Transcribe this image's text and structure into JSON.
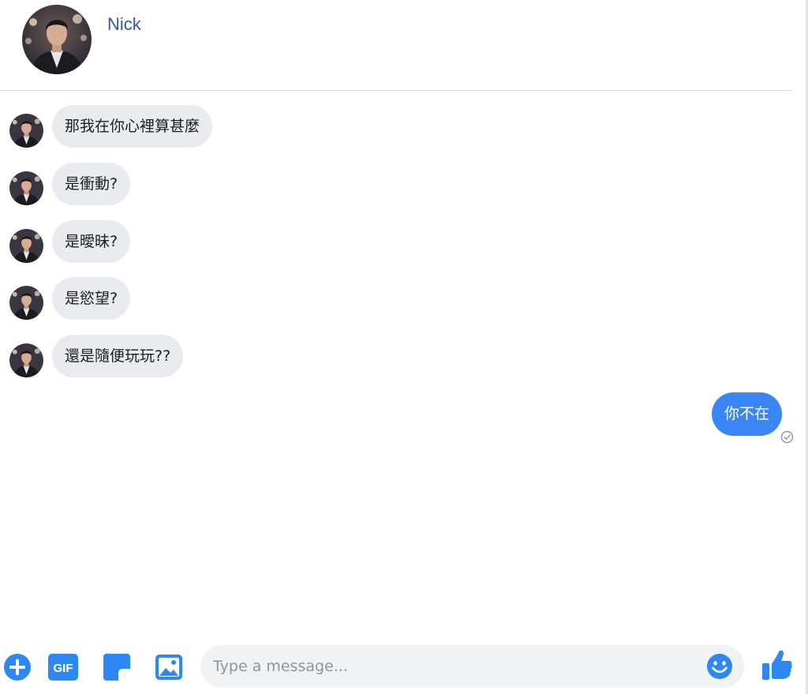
{
  "contact": {
    "name": "Nick",
    "avatar_icon": "profile-photo"
  },
  "messages": [
    {
      "direction": "incoming",
      "text": "那我在你心裡算甚麼"
    },
    {
      "direction": "incoming",
      "text": "是衝動?"
    },
    {
      "direction": "incoming",
      "text": "是曖昧?"
    },
    {
      "direction": "incoming",
      "text": "是慾望?"
    },
    {
      "direction": "incoming",
      "text": "還是隨便玩玩??"
    },
    {
      "direction": "outgoing",
      "text": "你不在",
      "status_icon": "sent-check-icon"
    }
  ],
  "composer": {
    "placeholder": "Type a message...",
    "tools": [
      {
        "name": "more-actions",
        "icon": "plus-circle-icon"
      },
      {
        "name": "gif",
        "icon": "gif-icon",
        "label": "GIF"
      },
      {
        "name": "sticker",
        "icon": "sticker-icon"
      },
      {
        "name": "photo",
        "icon": "image-icon"
      }
    ],
    "emoji_icon": "smiley-icon",
    "send_icon": "thumbs-up-icon"
  },
  "colors": {
    "accent": "#3a86f5",
    "incoming_bubble": "#e9ebee",
    "contact_name": "#365899",
    "input_bg": "#f1f2f4"
  }
}
